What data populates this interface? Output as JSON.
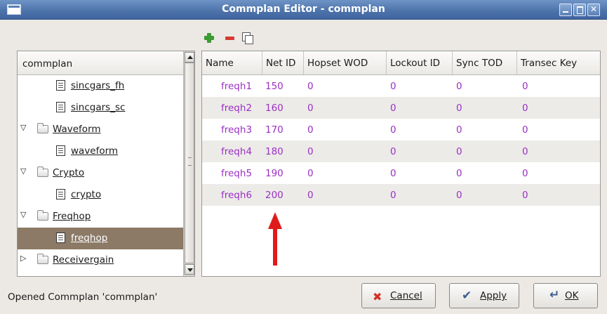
{
  "window": {
    "title": "Commplan Editor - commplan"
  },
  "toolbar": {
    "add_icon": "add-icon",
    "remove_icon": "remove-icon",
    "copy_icon": "copy-icon"
  },
  "tree": {
    "header": "commplan",
    "items": [
      {
        "label": "sincgars_fh",
        "type": "document",
        "level": 1
      },
      {
        "label": "sincgars_sc",
        "type": "document",
        "level": 1
      },
      {
        "label": "Waveform",
        "type": "folder",
        "expanded": true,
        "level": 0
      },
      {
        "label": "waveform",
        "type": "document",
        "level": 1
      },
      {
        "label": "Crypto",
        "type": "folder",
        "expanded": true,
        "level": 0
      },
      {
        "label": "crypto",
        "type": "document",
        "level": 1
      },
      {
        "label": "Freqhop",
        "type": "folder",
        "expanded": true,
        "level": 0
      },
      {
        "label": "freqhop",
        "type": "document",
        "level": 1,
        "selected": true
      },
      {
        "label": "Receivergain",
        "type": "folder",
        "expanded": false,
        "level": 0
      }
    ]
  },
  "table": {
    "columns": [
      "Name",
      "Net ID",
      "Hopset WOD",
      "Lockout ID",
      "Sync TOD",
      "Transec Key"
    ],
    "rows": [
      [
        "freqh1",
        "150",
        "0",
        "0",
        "0",
        "0"
      ],
      [
        "freqh2",
        "160",
        "0",
        "0",
        "0",
        "0"
      ],
      [
        "freqh3",
        "170",
        "0",
        "0",
        "0",
        "0"
      ],
      [
        "freqh4",
        "180",
        "0",
        "0",
        "0",
        "0"
      ],
      [
        "freqh5",
        "190",
        "0",
        "0",
        "0",
        "0"
      ],
      [
        "freqh6",
        "200",
        "0",
        "0",
        "0",
        "0"
      ]
    ]
  },
  "status": "Opened Commplan 'commplan'",
  "buttons": {
    "cancel": "Cancel",
    "apply": "Apply",
    "ok": "OK"
  },
  "colors": {
    "cell_text": "#9b2fc4",
    "selection": "#8c7a66",
    "annotation_arrow": "#e01b1b"
  }
}
